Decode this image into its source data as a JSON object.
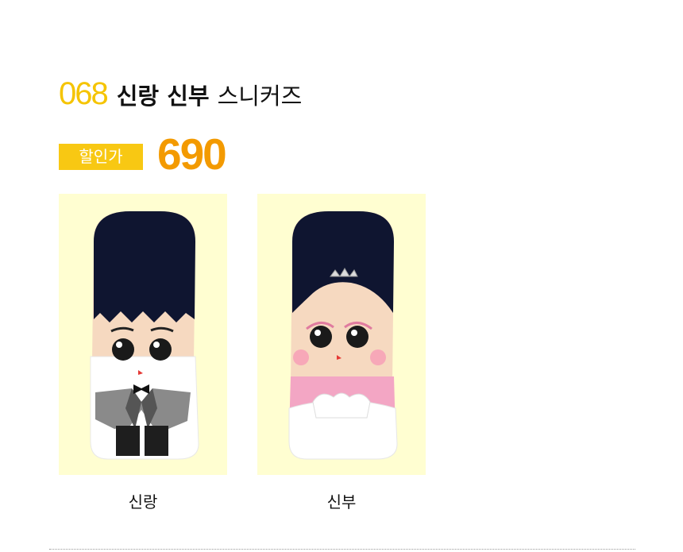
{
  "product": {
    "number": "068",
    "name_bold": "신랑 신부",
    "name_light": "스니커즈"
  },
  "price": {
    "badge": "할인가",
    "value": "690"
  },
  "options": [
    {
      "label": "신랑",
      "image": "groom-sock"
    },
    {
      "label": "신부",
      "image": "bride-sock"
    }
  ],
  "colors": {
    "number": "#f5c400",
    "badge_bg": "#f8c813",
    "price": "#f39a00",
    "card_bg": "#fffed1"
  }
}
